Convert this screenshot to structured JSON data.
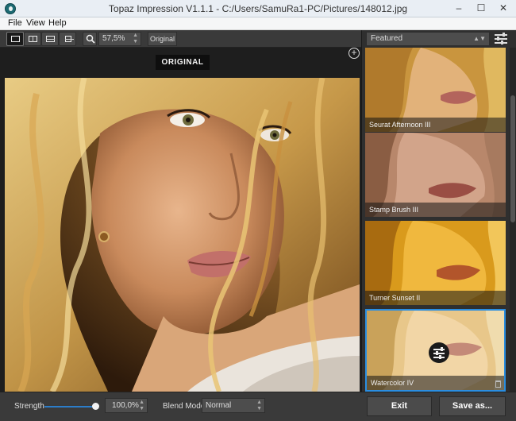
{
  "window": {
    "title": "Topaz Impression V1.1.1 - C:/Users/SamuRa1-PC/Pictures/148012.jpg",
    "minimize_glyph": "–",
    "maximize_glyph": "☐",
    "close_glyph": "✕"
  },
  "menu": {
    "items": [
      "File",
      "View",
      "Help"
    ]
  },
  "toolbar": {
    "zoom_value": "57,5%",
    "original_button": "Original",
    "view_modes": [
      "single-view",
      "split-vertical-view",
      "split-horizontal-view",
      "side-by-side-view",
      "stacked-view"
    ],
    "active_view": "single-view"
  },
  "canvas": {
    "label": "ORIGINAL",
    "add_glyph": "+"
  },
  "bottom": {
    "strength_label": "Strength",
    "strength_value": "100,0%",
    "strength_fraction": 1.0,
    "blend_label": "Blend Mode",
    "blend_value": "Normal",
    "exit_label": "Exit",
    "save_label": "Save as..."
  },
  "panel": {
    "category": "Featured",
    "presets": [
      {
        "name": "Seurat Afternoon III",
        "selected": false
      },
      {
        "name": "Stamp Brush III",
        "selected": false
      },
      {
        "name": "Turner Sunset II",
        "selected": false
      },
      {
        "name": "Watercolor IV",
        "selected": true
      }
    ]
  },
  "colors": {
    "accent": "#2b8ee0",
    "panel_bg": "#2f2f2f",
    "toolbar_bg": "#3a3a3a"
  }
}
